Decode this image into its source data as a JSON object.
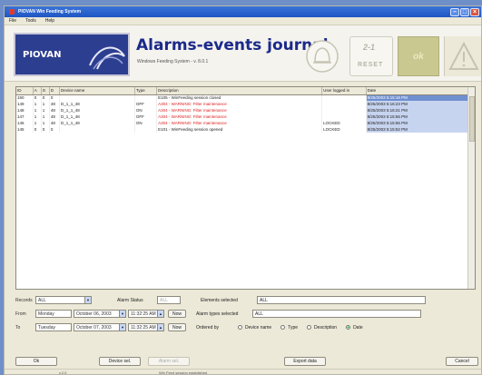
{
  "window": {
    "title": "PIOVAN Win Feeding System"
  },
  "menu": {
    "items": [
      "File",
      "Tools",
      "Help"
    ]
  },
  "banner": {
    "brand": "PIOVAN",
    "title": "Alarms-events journal",
    "subtitle": "Windows Feeding System  -  v. 8.0.1",
    "reset_label": "RESET",
    "reset_top": "2-1",
    "ok_label": "ok"
  },
  "table": {
    "headers": [
      "ID",
      "A",
      "G",
      "D",
      "Device name",
      "Type",
      "Description",
      "User logged in",
      "Date"
    ],
    "rows": [
      [
        "150",
        "0",
        "0",
        "0",
        "",
        "",
        "E105 - WinFeeding session closed",
        "",
        "8/25/2003 5:15:18 PM"
      ],
      [
        "149",
        "1",
        "1",
        "48",
        "D_1_1_48",
        "OFF",
        "A304 - WARNING: Filter maintenance",
        "",
        "8/25/2003 5:16:23 PM"
      ],
      [
        "148",
        "1",
        "1",
        "48",
        "D_1_1_48",
        "ON",
        "A304 - WARNING: Filter maintenance",
        "",
        "8/25/2003 5:16:21 PM"
      ],
      [
        "147",
        "1",
        "1",
        "48",
        "D_1_1_48",
        "OFF",
        "A304 - WARNING: Filter maintenance",
        "",
        "8/25/2003 5:15:56 PM"
      ],
      [
        "146",
        "1",
        "1",
        "48",
        "D_1_1_48",
        "ON",
        "A304 - WARNING: Filter maintenance",
        "LOCKED",
        "8/25/2003 5:15:55 PM"
      ],
      [
        "145",
        "0",
        "0",
        "0",
        "",
        "",
        "E101 - WinFeeding session opened",
        "LOCKED",
        "8/25/2003 5:15:52 PM"
      ]
    ]
  },
  "filters": {
    "records_label": "Records",
    "records_value": "ALL",
    "alarm_status_label": "Alarm Status",
    "alarm_status_value": "ALL",
    "from_label": "From",
    "from_day": "Monday",
    "from_date": "October 06, 2003",
    "from_time": "11:32:25 AM",
    "to_label": "To",
    "to_day": "Tuesday",
    "to_date": "October 07, 2003",
    "to_time": "11:32:25 AM",
    "now_label": "Now",
    "elements_selected_label": "Elements selected",
    "elements_selected_value": "ALL",
    "alarm_types_label": "Alarm types selected",
    "alarm_types_value": "ALL",
    "ordered_by_label": "Ordered by",
    "order_options": [
      "Device name",
      "Type",
      "Description",
      "Date"
    ],
    "order_selected": "Date"
  },
  "buttons": {
    "ok": "Ok",
    "device_sel": "Device sel.",
    "alarm_sel": "Alarm sel.",
    "export_data": "Export data",
    "cancel": "Cancel"
  },
  "status": {
    "left": "v.2.0",
    "message": "Win Feed session established"
  }
}
